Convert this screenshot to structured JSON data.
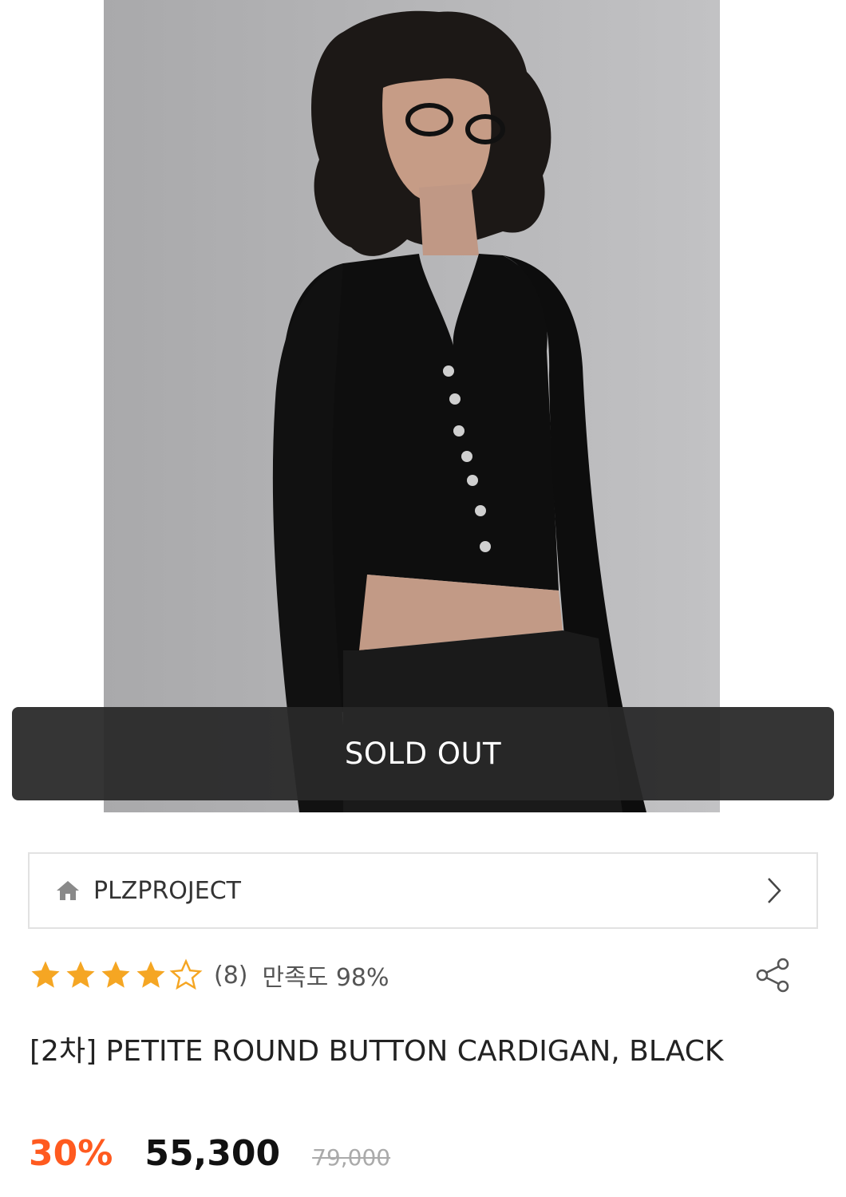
{
  "product_image": {
    "icon": "product-photo"
  },
  "status": {
    "sold_out_label": "SOLD OUT"
  },
  "brand": {
    "name": "PLZPROJECT",
    "icon": "home-icon",
    "chevron": "chevron-right-icon"
  },
  "rating": {
    "stars_filled": 4,
    "stars_total": 5,
    "review_count": "(8)",
    "satisfaction": "만족도 98%",
    "star_color": "#f5a623"
  },
  "share": {
    "icon": "share-icon"
  },
  "product": {
    "title": "[2차] PETITE ROUND BUTTON CARDIGAN, BLACK"
  },
  "price": {
    "discount": "30%",
    "sale": "55,300",
    "original": "79,000",
    "discount_color": "#ff5a1f"
  }
}
